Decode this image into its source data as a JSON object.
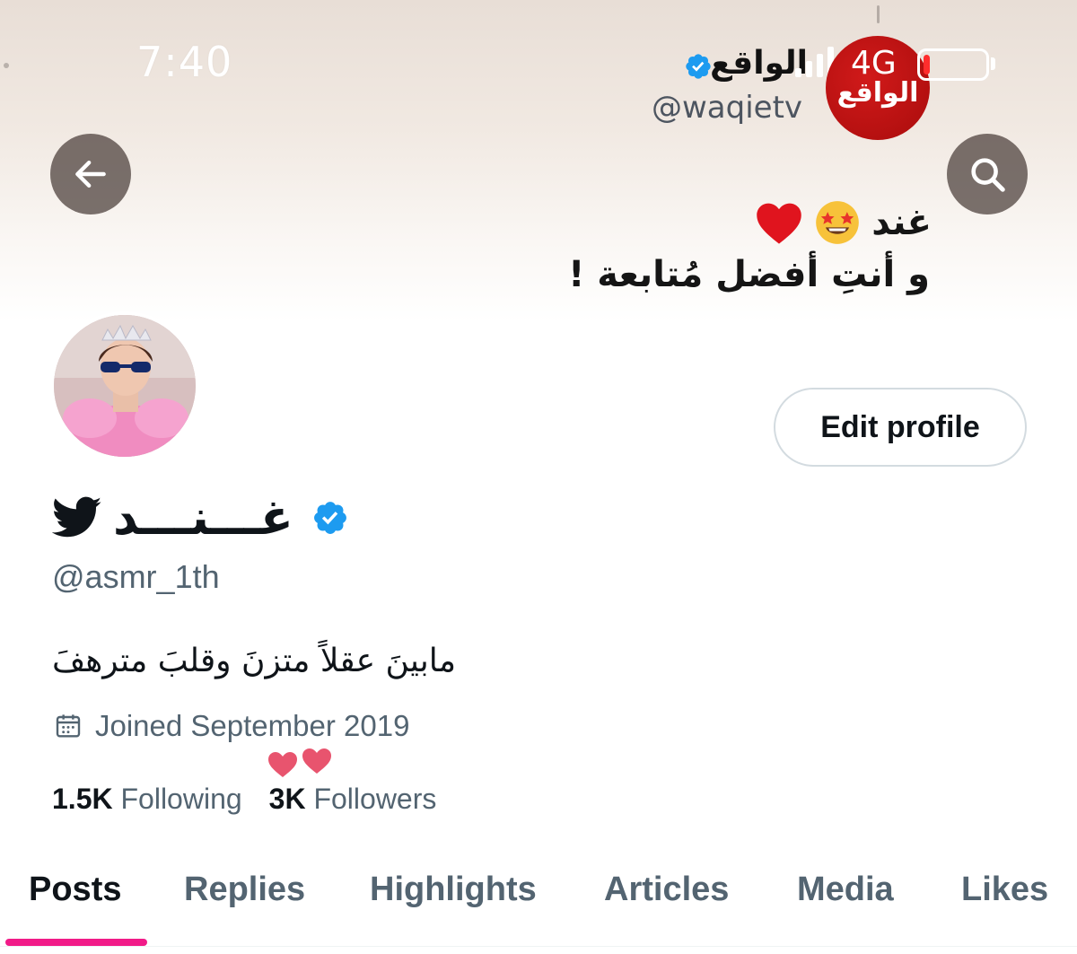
{
  "status_bar": {
    "time": "7:40",
    "network": "4G",
    "battery_level": 0.1
  },
  "banner": {
    "brand": {
      "logo_text": "الواقع",
      "name": "الواقع",
      "handle": "@waqietv"
    },
    "line1_text": "غند",
    "line1_emojis": [
      "star-struck-emoji",
      "red-heart-emoji"
    ],
    "line2_text": "و أنتِ أفضل مُتابعة !"
  },
  "profile": {
    "display_name": "غـــنـــد",
    "handle": "@asmr_1th",
    "bio": "مابينَ عقلاً متزنَ وقلبَ مترهفَ",
    "joined": "Joined September 2019",
    "following_count": "1.5K",
    "following_label": "Following",
    "followers_count": "3K",
    "followers_label": "Followers",
    "edit_button": "Edit profile"
  },
  "tabs": [
    {
      "label": "Posts",
      "active": true
    },
    {
      "label": "Replies",
      "active": false
    },
    {
      "label": "Highlights",
      "active": false
    },
    {
      "label": "Articles",
      "active": false
    },
    {
      "label": "Media",
      "active": false
    },
    {
      "label": "Likes",
      "active": false
    }
  ],
  "colors": {
    "accent": "#f11b88",
    "verified": "#1d9bf0",
    "text_primary": "#0f1419",
    "text_secondary": "#536471"
  }
}
